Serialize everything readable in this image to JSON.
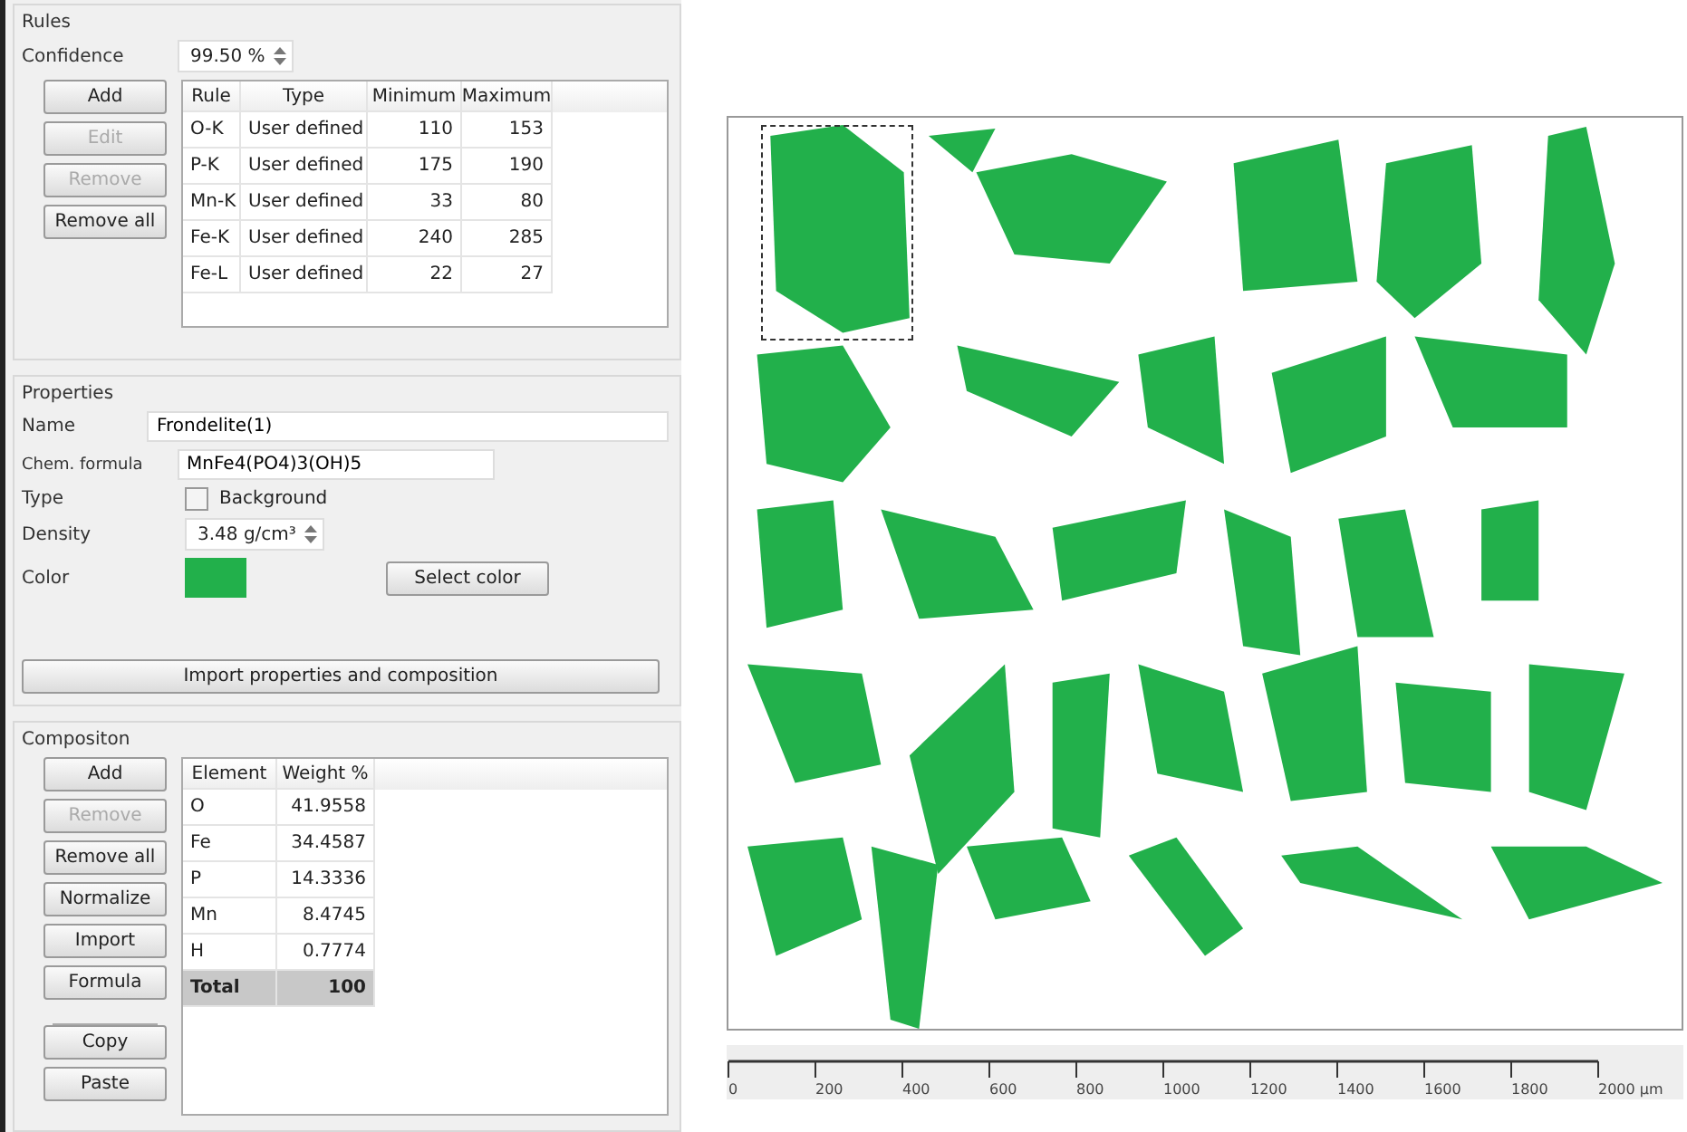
{
  "rules": {
    "title": "Rules",
    "confidence_label": "Confidence",
    "confidence_value": "99.50 %",
    "buttons": [
      {
        "label": "Add",
        "disabled": false
      },
      {
        "label": "Edit",
        "disabled": true
      },
      {
        "label": "Remove",
        "disabled": true
      },
      {
        "label": "Remove all",
        "disabled": false
      }
    ],
    "columns": [
      "Rule",
      "Type",
      "Minimum",
      "Maximum"
    ],
    "rows": [
      [
        "O-K",
        "User defined",
        "110",
        "153"
      ],
      [
        "P-K",
        "User defined",
        "175",
        "190"
      ],
      [
        "Mn-K",
        "User defined",
        "33",
        "80"
      ],
      [
        "Fe-K",
        "User defined",
        "240",
        "285"
      ],
      [
        "Fe-L",
        "User defined",
        "22",
        "27"
      ]
    ]
  },
  "properties": {
    "title": "Properties",
    "name_label": "Name",
    "name_value": "Frondelite(1)",
    "formula_label": "Chem. formula",
    "formula_value": "MnFe4(PO4)3(OH)5",
    "type_label": "Type",
    "background_label": "Background",
    "background_checked": false,
    "density_label": "Density",
    "density_value": "3.48 g/cm³",
    "color_label": "Color",
    "color": "#22b04b",
    "select_color_button": "Select color",
    "import_button": "Import properties and composition"
  },
  "composition": {
    "title": "Compositon",
    "buttons": [
      {
        "label": "Add",
        "disabled": false
      },
      {
        "label": "Remove",
        "disabled": true
      },
      {
        "label": "Remove all",
        "disabled": false
      },
      {
        "label": "Normalize",
        "disabled": false
      },
      {
        "label": "Import",
        "disabled": false
      },
      {
        "label": "Formula",
        "disabled": false
      },
      {
        "label": "Copy",
        "disabled": false,
        "separated": true
      },
      {
        "label": "Paste",
        "disabled": false
      }
    ],
    "columns": [
      "Element",
      "Weight %"
    ],
    "rows": [
      [
        "O",
        "41.9558"
      ],
      [
        "Fe",
        "34.4587"
      ],
      [
        "P",
        "14.3336"
      ],
      [
        "Mn",
        "8.4745"
      ],
      [
        "H",
        "0.7774"
      ]
    ],
    "total": [
      "Total",
      "100"
    ]
  },
  "scale_bar": {
    "labels": [
      "0",
      "200",
      "400",
      "600",
      "800",
      "1000",
      "1200",
      "1400",
      "1600",
      "1800",
      "2000 µm"
    ]
  }
}
